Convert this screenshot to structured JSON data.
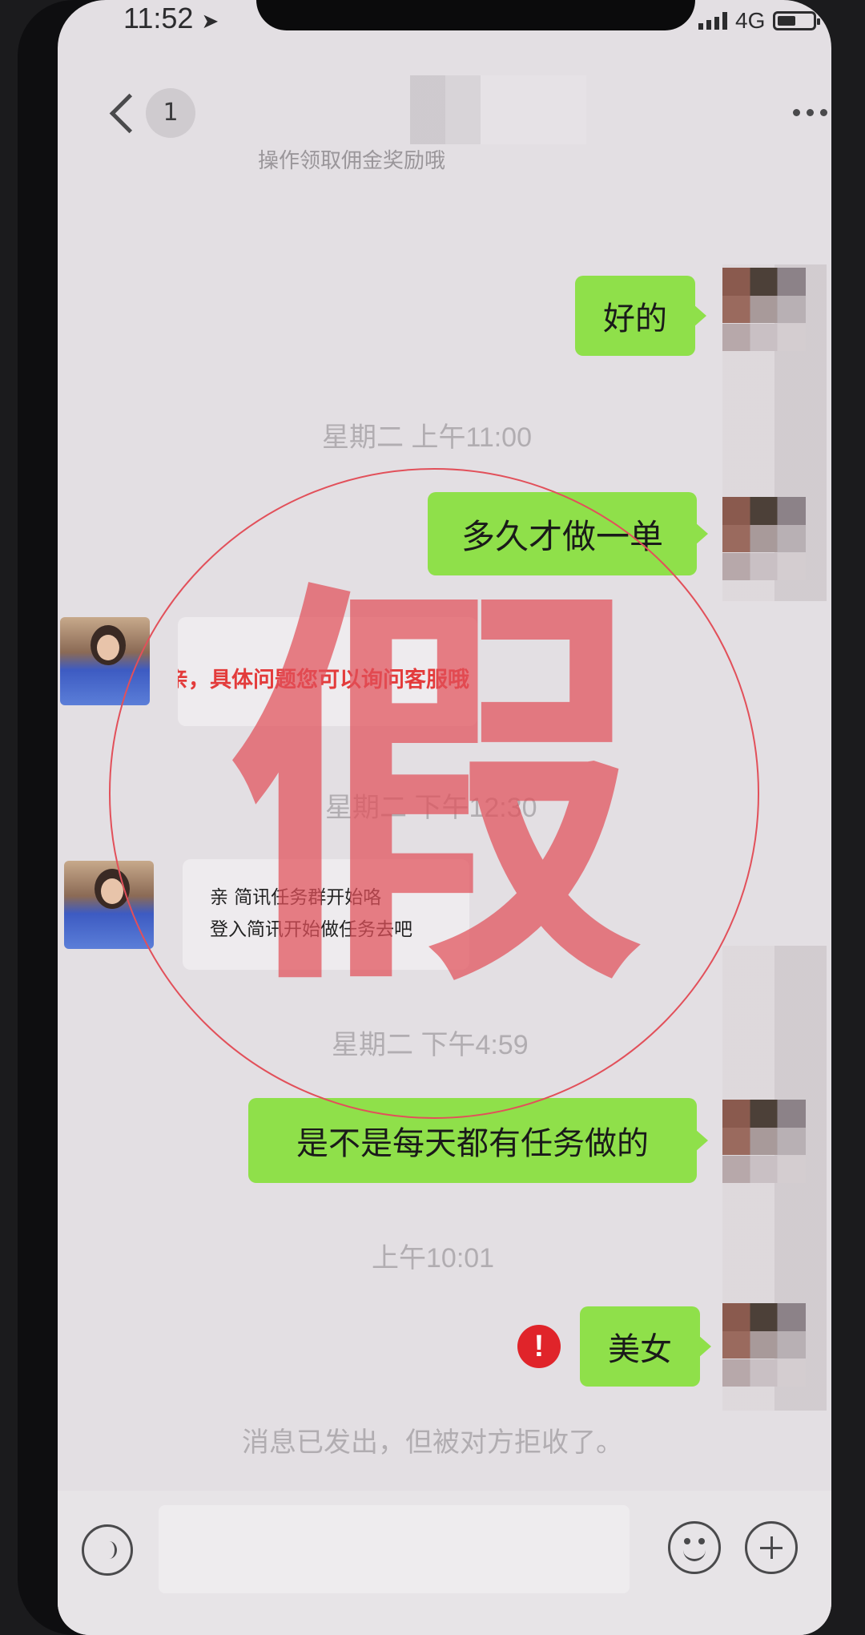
{
  "status_bar": {
    "time": "11:52",
    "network": "4G"
  },
  "nav": {
    "unread_count": "1",
    "subtitle": "操作领取佣金奖励哦"
  },
  "messages": {
    "m1": "好的",
    "t1": "星期二 上午11:00",
    "m2": "多久才做一单",
    "m3": "亲，具体问题您可以询问客服哦",
    "t2": "星期二 下午12:30",
    "m4_line1": "亲 简讯任务群开始咯",
    "m4_line2": "登入简讯开始做任务去吧",
    "t3": "星期二 下午4:59",
    "m5": "是不是每天都有任务做的",
    "t4": "上午10:01",
    "m6": "美女",
    "rejected_notice": "消息已发出，但被对方拒收了。"
  },
  "overlay": {
    "stamp_char": "假",
    "stamp_color": "#e2505a"
  },
  "colors": {
    "bubble_out": "#8fe04a",
    "alert": "#e0242a"
  },
  "icons": [
    "location-arrow-icon",
    "signal-icon",
    "battery-icon",
    "back-chevron-icon",
    "more-dots-icon",
    "alert-icon",
    "voice-icon",
    "emoji-icon",
    "plus-icon"
  ]
}
